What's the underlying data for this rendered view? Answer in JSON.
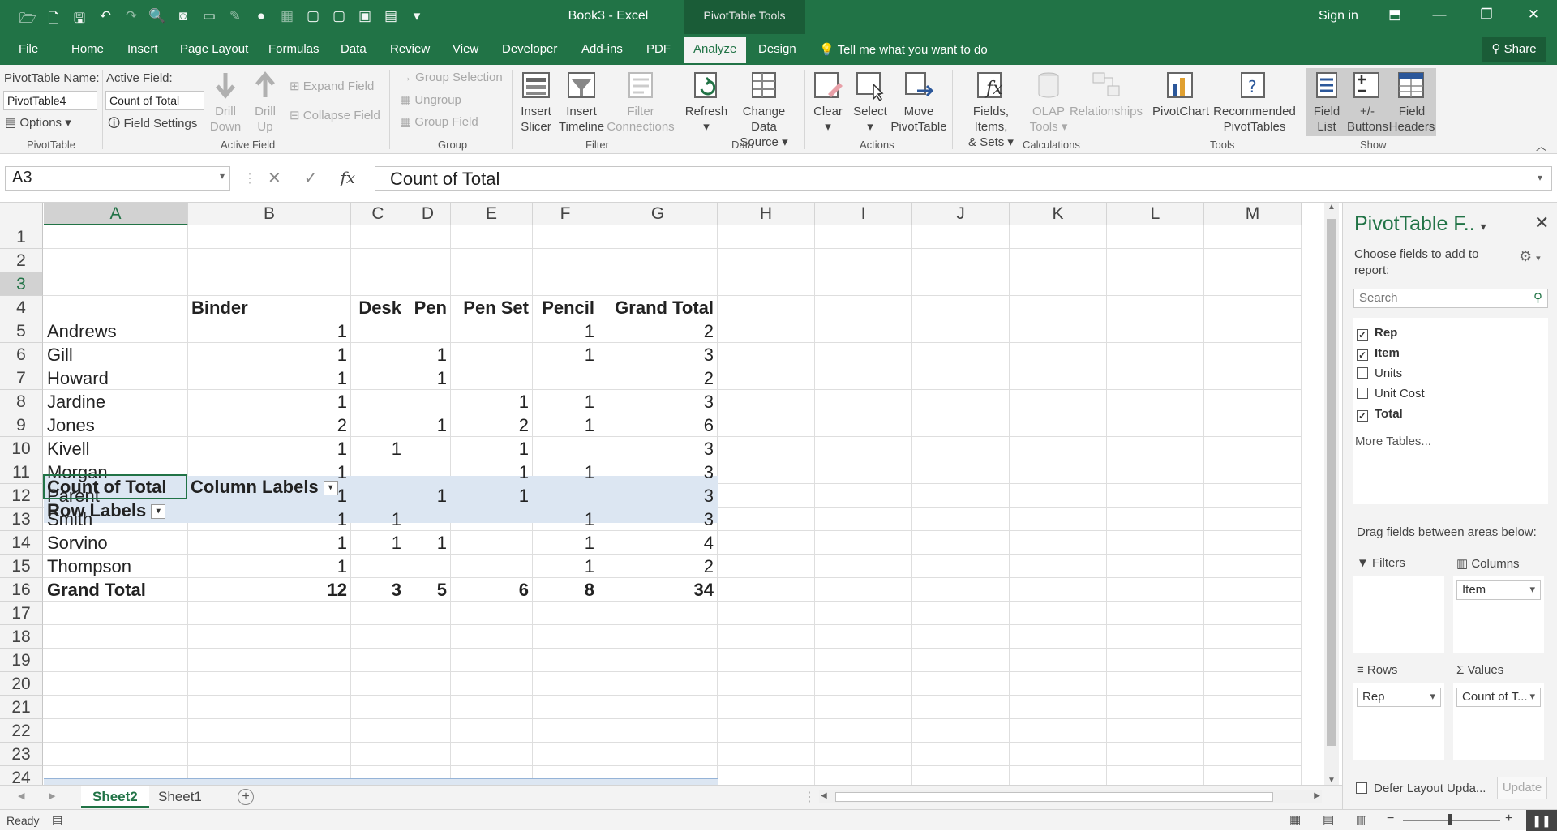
{
  "window": {
    "title": "Book3 - Excel",
    "tools_label": "PivotTable Tools",
    "sign_in": "Sign in"
  },
  "tabs": [
    "File",
    "Home",
    "Insert",
    "Page Layout",
    "Formulas",
    "Data",
    "Review",
    "View",
    "Developer",
    "Add-ins",
    "PDF",
    "Analyze",
    "Design"
  ],
  "active_tab": "Analyze",
  "tell_me": "Tell me what you want to do",
  "share": "Share",
  "ribbon": {
    "pivottable_name_label": "PivotTable Name:",
    "pivottable_name_value": "PivotTable4",
    "options": "Options",
    "pivottable_group": "PivotTable",
    "active_field_label": "Active Field:",
    "active_field_value": "Count of Total",
    "field_settings": "Field Settings",
    "drill_down": [
      "Drill",
      "Down"
    ],
    "drill_up": [
      "Drill",
      "Up"
    ],
    "expand_field": "Expand Field",
    "collapse_field": "Collapse Field",
    "active_field_group": "Active Field",
    "group_selection": "Group Selection",
    "ungroup": "Ungroup",
    "group_field": "Group Field",
    "group_group": "Group",
    "insert_slicer": [
      "Insert",
      "Slicer"
    ],
    "insert_timeline": [
      "Insert",
      "Timeline"
    ],
    "filter_connections": [
      "Filter",
      "Connections"
    ],
    "filter_group": "Filter",
    "refresh": "Refresh",
    "change_data_source": [
      "Change Data",
      "Source"
    ],
    "data_group": "Data",
    "clear": "Clear",
    "select": "Select",
    "move_pivottable": [
      "Move",
      "PivotTable"
    ],
    "actions_group": "Actions",
    "fields_items_sets": [
      "Fields, Items,",
      "& Sets"
    ],
    "olap_tools": [
      "OLAP",
      "Tools"
    ],
    "relationships": "Relationships",
    "calculations_group": "Calculations",
    "pivotchart": "PivotChart",
    "recommended_pivottables": [
      "Recommended",
      "PivotTables"
    ],
    "tools_group": "Tools",
    "field_list": [
      "Field",
      "List"
    ],
    "plus_minus_buttons": [
      "+/-",
      "Buttons"
    ],
    "field_headers": [
      "Field",
      "Headers"
    ],
    "show_group": "Show"
  },
  "formula_bar": {
    "name_box": "A3",
    "formula": "Count of Total",
    "fx": "fx"
  },
  "grid": {
    "columns": [
      "A",
      "B",
      "C",
      "D",
      "E",
      "F",
      "G",
      "H",
      "I",
      "J",
      "K",
      "L",
      "M"
    ],
    "rows": [
      "1",
      "2",
      "3",
      "4",
      "5",
      "6",
      "7",
      "8",
      "9",
      "10",
      "11",
      "12",
      "13",
      "14",
      "15",
      "16",
      "17",
      "18",
      "19",
      "20",
      "21",
      "22",
      "23",
      "24"
    ],
    "selected_cell": "A3"
  },
  "pivot": {
    "value_header": "Count of Total",
    "column_labels": "Column Labels",
    "row_labels": "Row Labels",
    "columns": [
      "Binder",
      "Desk",
      "Pen",
      "Pen Set",
      "Pencil",
      "Grand Total"
    ],
    "rows": [
      {
        "rep": "Andrews",
        "values": [
          "1",
          "",
          "",
          "",
          "1",
          "2"
        ]
      },
      {
        "rep": "Gill",
        "values": [
          "1",
          "",
          "1",
          "",
          "1",
          "3"
        ]
      },
      {
        "rep": "Howard",
        "values": [
          "1",
          "",
          "1",
          "",
          "",
          "2"
        ]
      },
      {
        "rep": "Jardine",
        "values": [
          "1",
          "",
          "",
          "1",
          "1",
          "3"
        ]
      },
      {
        "rep": "Jones",
        "values": [
          "2",
          "",
          "1",
          "2",
          "1",
          "6"
        ]
      },
      {
        "rep": "Kivell",
        "values": [
          "1",
          "1",
          "",
          "1",
          "",
          "3"
        ]
      },
      {
        "rep": "Morgan",
        "values": [
          "1",
          "",
          "",
          "1",
          "1",
          "3"
        ]
      },
      {
        "rep": "Parent",
        "values": [
          "1",
          "",
          "1",
          "1",
          "",
          "3"
        ]
      },
      {
        "rep": "Smith",
        "values": [
          "1",
          "1",
          "",
          "",
          "1",
          "3"
        ]
      },
      {
        "rep": "Sorvino",
        "values": [
          "1",
          "1",
          "1",
          "",
          "1",
          "4"
        ]
      },
      {
        "rep": "Thompson",
        "values": [
          "1",
          "",
          "",
          "",
          "1",
          "2"
        ]
      }
    ],
    "grand_total_label": "Grand Total",
    "grand_totals": [
      "12",
      "3",
      "5",
      "6",
      "8",
      "34"
    ]
  },
  "sheets": [
    "Sheet2",
    "Sheet1"
  ],
  "active_sheet": "Sheet2",
  "status": "Ready",
  "pane": {
    "title": "PivotTable F..",
    "subtitle": "Choose fields to add to report:",
    "search_placeholder": "Search",
    "fields": [
      {
        "name": "Rep",
        "checked": true
      },
      {
        "name": "Item",
        "checked": true
      },
      {
        "name": "Units",
        "checked": false
      },
      {
        "name": "Unit Cost",
        "checked": false
      },
      {
        "name": "Total",
        "checked": true
      }
    ],
    "more_tables": "More Tables...",
    "drag_label": "Drag fields between areas below:",
    "filters": "Filters",
    "columns": "Columns",
    "columns_value": "Item",
    "rows": "Rows",
    "rows_value": "Rep",
    "values": "Values",
    "values_value": "Count of T...",
    "defer": "Defer Layout Upda...",
    "update": "Update"
  },
  "colors": {
    "accent": "#217346",
    "pivot_header": "#dce6f2"
  }
}
